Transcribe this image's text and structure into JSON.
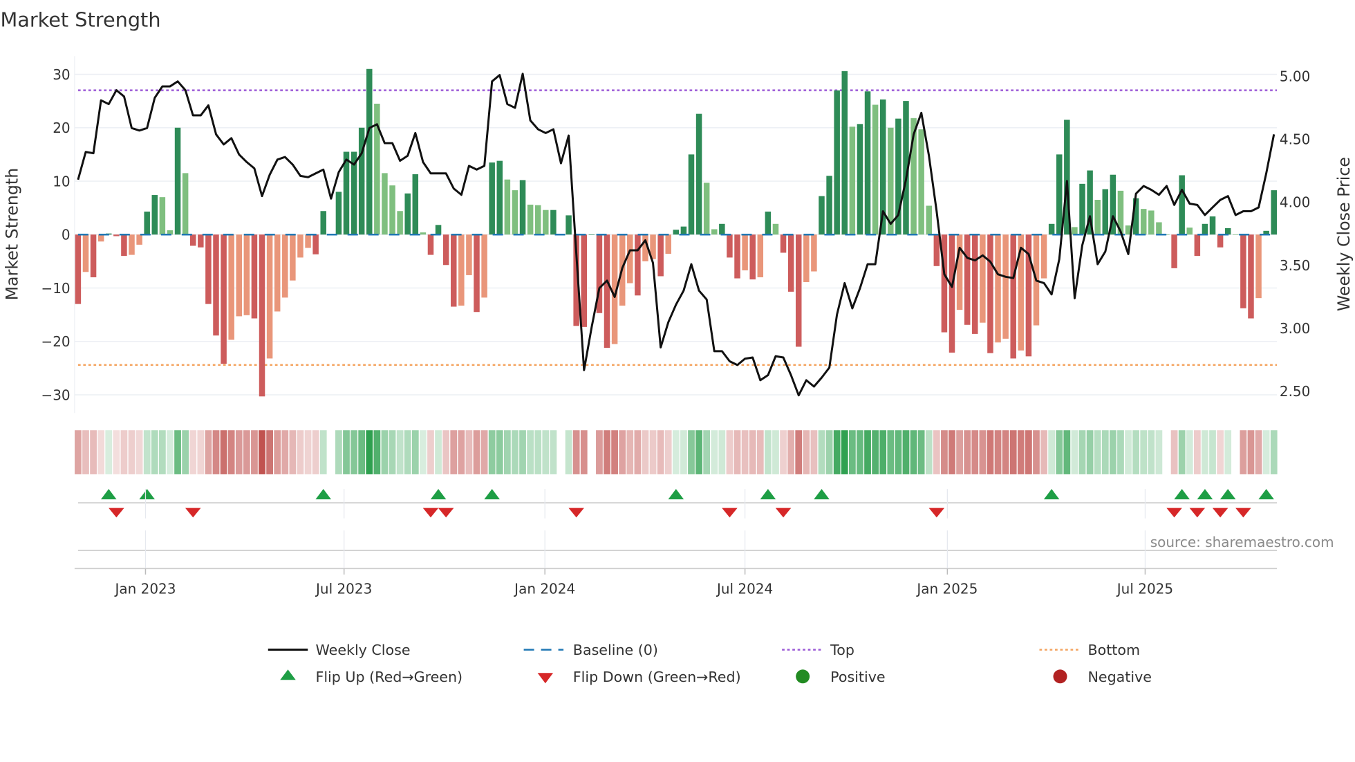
{
  "chart_data": {
    "type": "bar",
    "title": "Market Strength",
    "ylabel": "Market Strength",
    "ylabel_right": "Weekly Close Price",
    "ylim": [
      -33.4,
      33.4
    ],
    "ylim_right": [
      2.32,
      5.15
    ],
    "y_ticks": [
      30,
      20,
      10,
      0,
      -10,
      -20,
      -30
    ],
    "y_tick_labels": [
      "30",
      "20",
      "10",
      "0",
      "−10",
      "−20",
      "−30"
    ],
    "y_ticks_right": [
      5.0,
      4.5,
      4.0,
      3.5,
      3.0,
      2.5
    ],
    "y_tick_labels_right": [
      "5.00",
      "4.50",
      "4.00",
      "3.50",
      "3.00",
      "2.50"
    ],
    "x_unit": "week index",
    "x_ticks": [
      8.8,
      34.7,
      60.9,
      87.0,
      113.4,
      139.2
    ],
    "x_tick_labels": [
      "Jan 2023",
      "Jul 2023",
      "Jan 2024",
      "Jul 2024",
      "Jan 2025",
      "Jul 2025"
    ],
    "grid": true,
    "top_level": 27.0,
    "bottom_level": -24.4,
    "baseline": 0,
    "strength": [
      -13,
      -7,
      -8,
      -1.3,
      0.2,
      -0.3,
      -4,
      -3.8,
      -1.9,
      4.3,
      7.4,
      7,
      0.8,
      20,
      11.5,
      -2.1,
      -2.4,
      -13,
      -18.9,
      -24.2,
      -19.7,
      -15.3,
      -15.1,
      -15.7,
      -30.3,
      -23.2,
      -14.4,
      -11.8,
      -8.6,
      -4.3,
      -2.5,
      -3.7,
      4.4,
      0,
      8,
      15.5,
      15.5,
      20,
      31,
      24.5,
      11.5,
      9.2,
      4.4,
      7.7,
      11.3,
      0.4,
      -3.8,
      1.8,
      -5.7,
      -13.5,
      -13.3,
      -7.6,
      -14.5,
      -11.8,
      13.5,
      13.8,
      10.3,
      8.3,
      10.2,
      5.6,
      5.5,
      4.6,
      4.6,
      0,
      3.6,
      -17.1,
      -17.3,
      0,
      -14.7,
      -21.2,
      -20.5,
      -13.3,
      -9.1,
      -11.4,
      -5,
      -4.6,
      -7.8,
      -3.6,
      0.9,
      1.5,
      15,
      22.6,
      9.7,
      1,
      2,
      -4.3,
      -8.2,
      -6.7,
      -8.4,
      -8,
      4.3,
      2,
      -3.4,
      -10.7,
      -21,
      -8.9,
      -6.9,
      7.2,
      11,
      27,
      30.6,
      20.2,
      20.7,
      26.8,
      24.3,
      25.3,
      20,
      21.7,
      25,
      21.8,
      19.7,
      5.4,
      -5.9,
      -18.3,
      -22.1,
      -14.1,
      -16.9,
      -18.6,
      -16.5,
      -22.2,
      -20.2,
      -19.5,
      -23.2,
      -21.7,
      -22.8,
      -17,
      -8.2,
      2,
      15,
      21.5,
      1.4,
      9.5,
      12,
      6.5,
      8.5,
      11.2,
      8.2,
      1.7,
      6.8,
      4.8,
      4.5,
      2.3,
      0,
      -6.3,
      11.1,
      1.3,
      -4,
      2,
      3.4,
      -2.4,
      1.2,
      0,
      -13.8,
      -15.7,
      -11.9,
      0.7,
      8.3
    ],
    "weekly_close": [
      4.17,
      4.39,
      4.38,
      4.8,
      4.77,
      4.88,
      4.83,
      4.58,
      4.56,
      4.58,
      4.82,
      4.91,
      4.91,
      4.95,
      4.88,
      4.68,
      4.68,
      4.76,
      4.53,
      4.45,
      4.5,
      4.37,
      4.31,
      4.26,
      4.04,
      4.21,
      4.33,
      4.35,
      4.29,
      4.2,
      4.19,
      4.22,
      4.25,
      4.02,
      4.23,
      4.33,
      4.29,
      4.38,
      4.58,
      4.61,
      4.46,
      4.46,
      4.32,
      4.36,
      4.54,
      4.31,
      4.22,
      4.22,
      4.22,
      4.1,
      4.05,
      4.28,
      4.25,
      4.28,
      4.95,
      5.0,
      4.77,
      4.74,
      5.01,
      4.64,
      4.57,
      4.54,
      4.57,
      4.3,
      4.52,
      3.58,
      2.66,
      3.0,
      3.31,
      3.37,
      3.24,
      3.47,
      3.61,
      3.61,
      3.69,
      3.51,
      2.84,
      3.04,
      3.18,
      3.29,
      3.5,
      3.29,
      3.22,
      2.81,
      2.81,
      2.73,
      2.7,
      2.75,
      2.76,
      2.58,
      2.62,
      2.77,
      2.76,
      2.62,
      2.46,
      2.58,
      2.53,
      2.6,
      2.68,
      3.1,
      3.35,
      3.15,
      3.31,
      3.5,
      3.5,
      3.92,
      3.82,
      3.89,
      4.17,
      4.53,
      4.7,
      4.36,
      3.92,
      3.42,
      3.32,
      3.63,
      3.55,
      3.53,
      3.57,
      3.52,
      3.42,
      3.4,
      3.39,
      3.63,
      3.58,
      3.37,
      3.35,
      3.26,
      3.54,
      4.16,
      3.23,
      3.65,
      3.88,
      3.5,
      3.6,
      3.88,
      3.76,
      3.58,
      4.06,
      4.12,
      4.09,
      4.05,
      4.12,
      3.97,
      4.09,
      3.98,
      3.97,
      3.89,
      3.95,
      4.01,
      4.04,
      3.89,
      3.92,
      3.92,
      3.95,
      4.22,
      4.53
    ],
    "flip_up_weeks": [
      4,
      9,
      32,
      47,
      54,
      78,
      90,
      97,
      127,
      144,
      147,
      150,
      155
    ],
    "flip_down_weeks": [
      5,
      15,
      46,
      48,
      65,
      85,
      92,
      112,
      143,
      146,
      149,
      152
    ],
    "colors": {
      "strong_up": "#2e8b57",
      "weak_up": "#7fbf7f",
      "strong_down": "#cd5c5c",
      "weak_down": "#e9967a",
      "close": "#111111",
      "baseline": "#1f77b4",
      "top": "#9b59d6",
      "bottom": "#f4a460",
      "flip_up": "#1e9e45",
      "flip_down": "#d62728",
      "positive": "#228b22",
      "negative": "#b22222"
    },
    "legend_placement": "bottom-center",
    "legend": [
      {
        "label": "Weekly Close"
      },
      {
        "label": "Baseline (0)"
      },
      {
        "label": "Top"
      },
      {
        "label": "Bottom"
      },
      {
        "label": "Flip Up (Red→Green)"
      },
      {
        "label": "Flip Down (Green→Red)"
      },
      {
        "label": "Positive"
      },
      {
        "label": "Negative"
      }
    ],
    "source_note": "source: sharemaestro.com"
  }
}
